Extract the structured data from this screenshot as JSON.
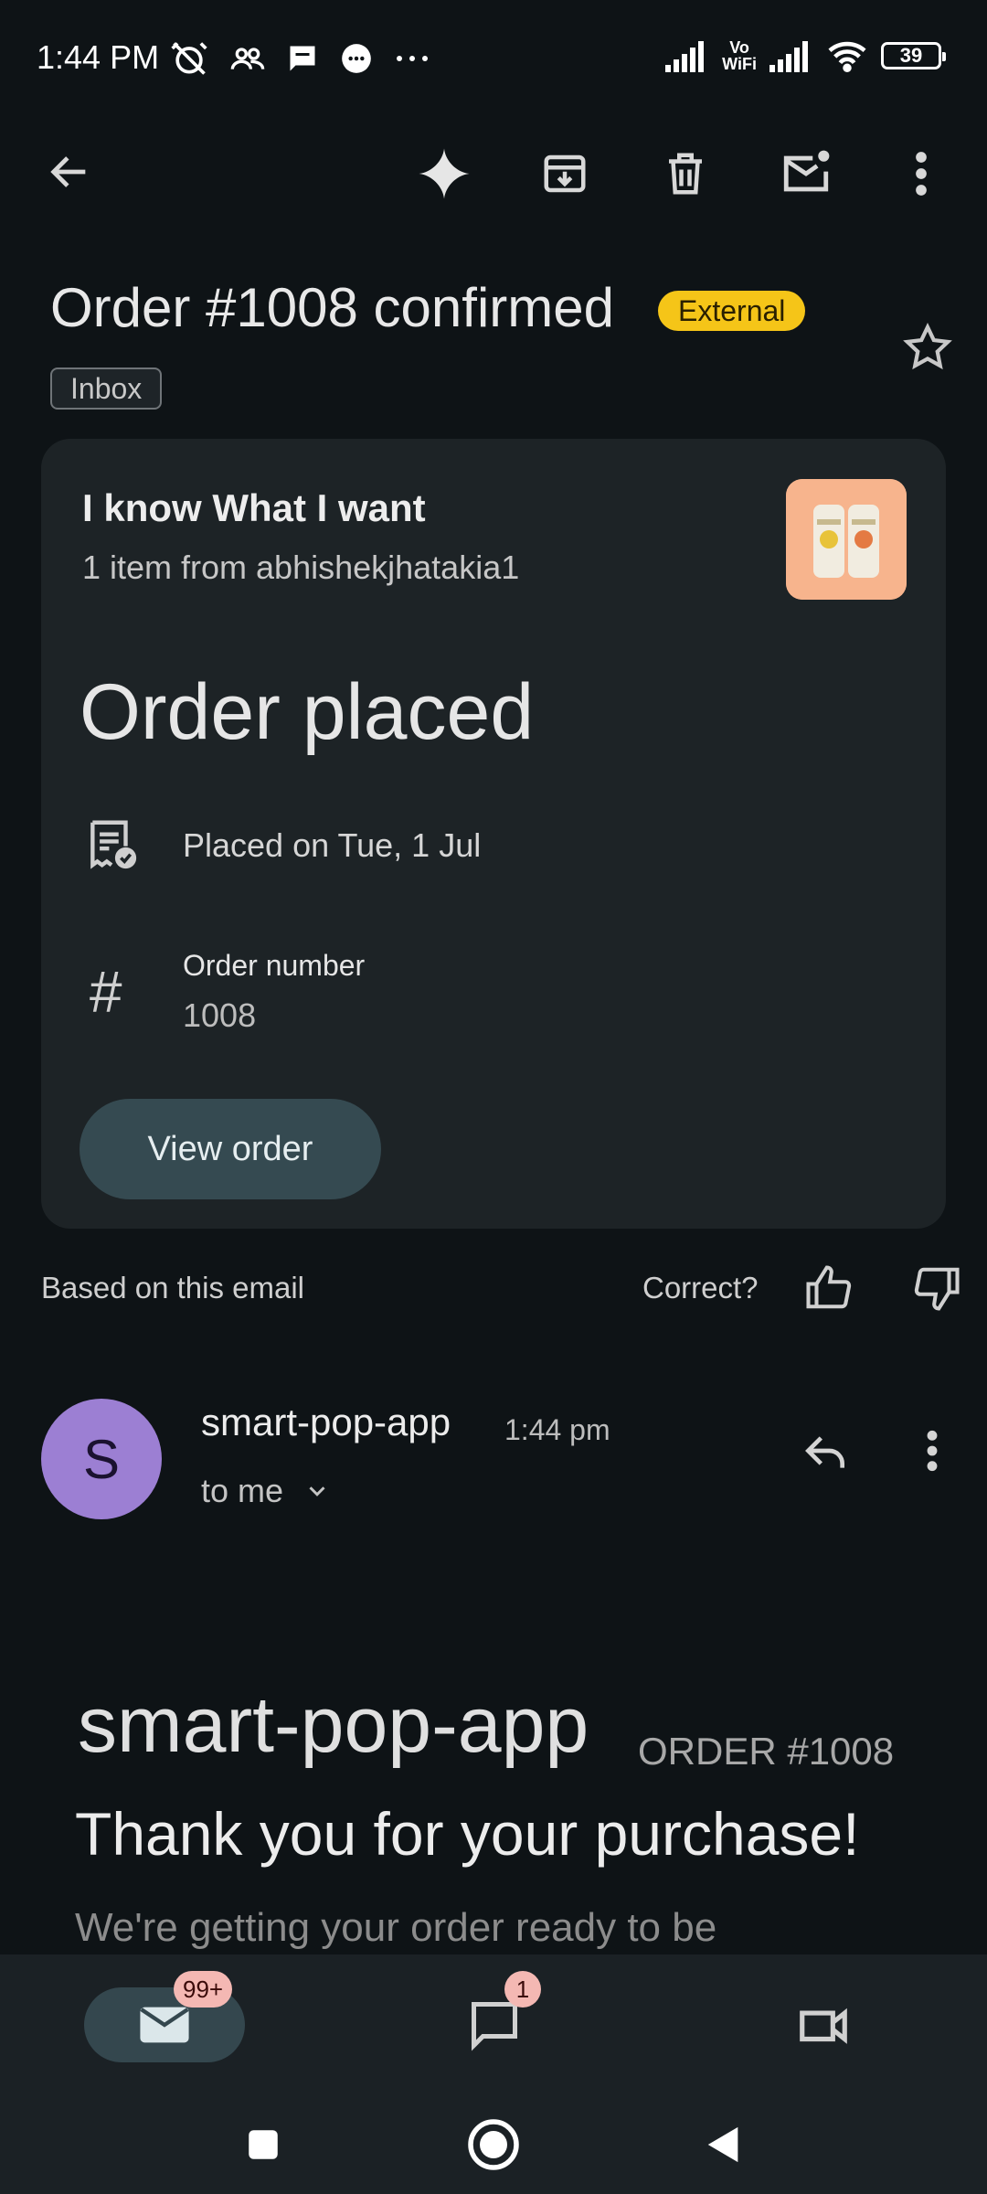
{
  "status_bar": {
    "time": "1:44 PM",
    "vowifi_top": "Vo",
    "vowifi_bottom": "WiFi",
    "battery": "39"
  },
  "toolbar": {
    "icons": [
      "back-arrow-icon",
      "gemini-sparkle-icon",
      "archive-icon",
      "delete-icon",
      "mark-unread-icon",
      "more-vert-icon"
    ]
  },
  "email": {
    "subject": "Order #1008 confirmed",
    "external_label": "External",
    "inbox_label": "Inbox"
  },
  "order_card": {
    "title": "I know What I want",
    "subtitle": "1 item from abhishekjhatakia1",
    "status": "Order placed",
    "placed_on": "Placed on Tue, 1 Jul",
    "order_number_label": "Order number",
    "order_number_value": "1008",
    "view_order_label": "View order"
  },
  "feedback": {
    "based_on": "Based on this email",
    "correct": "Correct?"
  },
  "sender": {
    "avatar_letter": "S",
    "name": "smart-pop-app",
    "time": "1:44 pm",
    "to": "to me"
  },
  "body": {
    "shop_name": "smart-pop-app",
    "order_ref": "ORDER #1008",
    "thanks": "Thank you for your purchase!",
    "text": "We're getting your order ready to be"
  },
  "bottom_nav": {
    "mail_badge": "99+",
    "chat_badge": "1"
  },
  "colors": {
    "background": "#0e1316",
    "card": "#1d2326",
    "external_badge": "#f5c518",
    "avatar": "#9c7fd3",
    "button": "#354a51"
  }
}
